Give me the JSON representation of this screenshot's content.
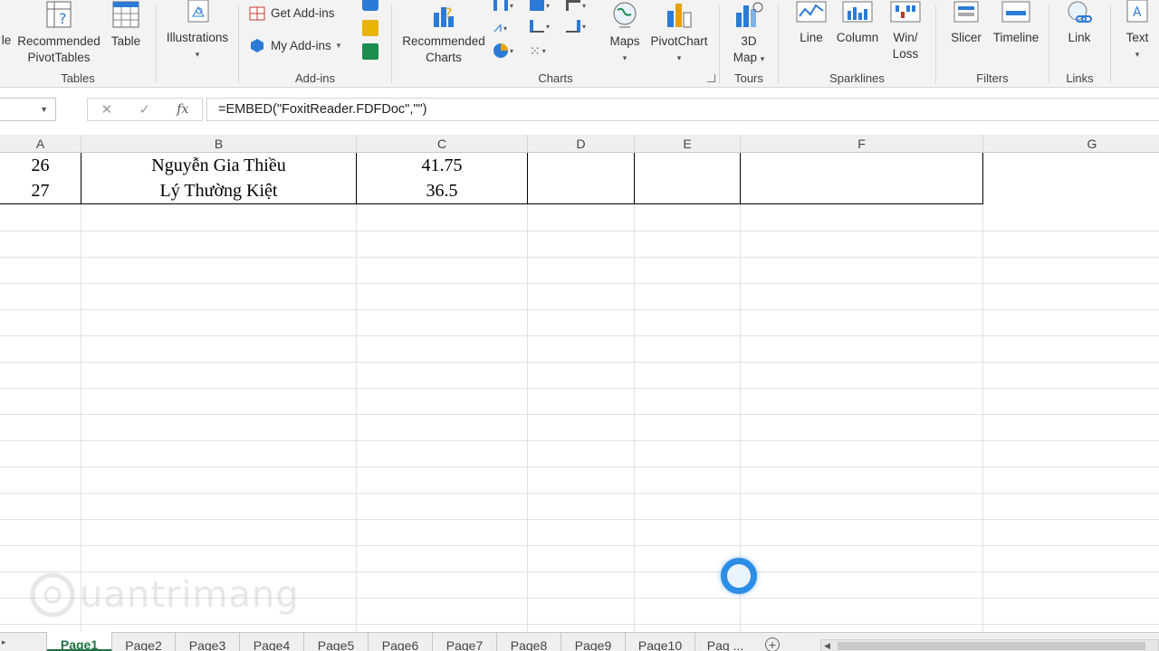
{
  "ribbon": {
    "groups": {
      "tables": {
        "label": "Tables",
        "recommended_pivot_line1": "Recommended",
        "recommended_pivot_line2": "PivotTables",
        "table": "Table",
        "partial_left": "le"
      },
      "illustrations": {
        "label": "Illustrations"
      },
      "addins": {
        "label": "Add-ins",
        "get": "Get Add-ins",
        "my": "My Add-ins"
      },
      "charts": {
        "label": "Charts",
        "recommended_line1": "Recommended",
        "recommended_line2": "Charts",
        "maps": "Maps",
        "pivotchart": "PivotChart"
      },
      "tours": {
        "label": "Tours",
        "map_line1": "3D",
        "map_line2": "Map"
      },
      "sparklines": {
        "label": "Sparklines",
        "line": "Line",
        "column": "Column",
        "winloss_line1": "Win/",
        "winloss_line2": "Loss"
      },
      "filters": {
        "label": "Filters",
        "slicer": "Slicer",
        "timeline": "Timeline"
      },
      "links": {
        "label": "Links",
        "link": "Link"
      },
      "text": {
        "label": "Text"
      }
    }
  },
  "formula_bar": {
    "cancel": "✕",
    "enter": "✓",
    "fx": "fx",
    "formula": "=EMBED(\"FoxitReader.FDFDoc\",\"\")"
  },
  "columns": [
    "A",
    "B",
    "C",
    "D",
    "E",
    "F",
    "G"
  ],
  "rows": [
    {
      "a": "26",
      "b": "Nguyễn Gia Thiều",
      "c": "41.75",
      "d": "",
      "e": "",
      "f": ""
    },
    {
      "a": "27",
      "b": "Lý Thường Kiệt",
      "c": "36.5",
      "d": "",
      "e": "",
      "f": ""
    }
  ],
  "sheet_tabs": [
    "Page1",
    "Page2",
    "Page3",
    "Page4",
    "Page5",
    "Page6",
    "Page7",
    "Page8",
    "Page9",
    "Page10",
    "Pag ..."
  ],
  "active_sheet": "Page1",
  "watermark": "uantrimang",
  "colors": {
    "accent_green": "#217346",
    "spinner_blue": "#2b8de6"
  }
}
